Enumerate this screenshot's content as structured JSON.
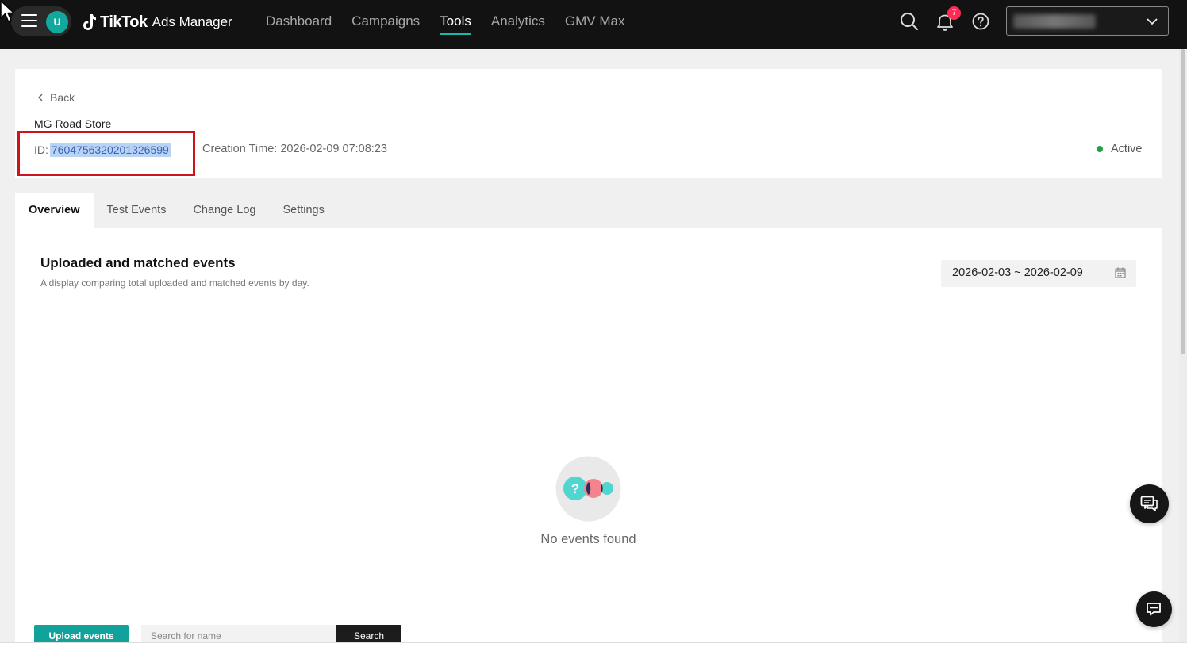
{
  "topbar": {
    "avatar_initial": "U",
    "brand": "TikTok",
    "brand_sub": "Ads Manager",
    "nav": [
      {
        "label": "Dashboard"
      },
      {
        "label": "Campaigns"
      },
      {
        "label": "Tools"
      },
      {
        "label": "Analytics"
      },
      {
        "label": "GMV Max"
      }
    ],
    "active_nav": "Tools",
    "notification_count": "7",
    "accent_color": "#19b8ad",
    "badge_color": "#fe2c55"
  },
  "header": {
    "back_label": "Back",
    "store_name": "MG Road Store",
    "id_label": "ID:",
    "id_value": "7604756320201326599",
    "creation_time": "Creation Time: 2026-02-09 07:08:23",
    "status": "Active",
    "status_color": "#24a148"
  },
  "tabs": [
    {
      "label": "Overview"
    },
    {
      "label": "Test Events"
    },
    {
      "label": "Change Log"
    },
    {
      "label": "Settings"
    }
  ],
  "active_tab": "Overview",
  "overview": {
    "title": "Uploaded and matched events",
    "description": "A display comparing total uploaded and matched events by day.",
    "date_range": "2026-02-03 ~ 2026-02-09",
    "empty_message": "No events found"
  },
  "actions": {
    "upload_label": "Upload events",
    "search_placeholder": "Search for name",
    "search_label": "Search"
  },
  "highlight_color": "#d0121b"
}
